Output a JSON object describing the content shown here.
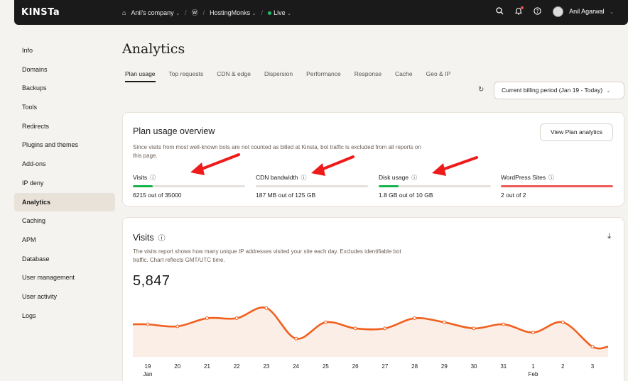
{
  "topbar": {
    "logo": "KINSTa",
    "company": "Anil's company",
    "site": "HostingMonks",
    "env": "Live",
    "user_name": "Anil Agarwal"
  },
  "sidebar": {
    "items": [
      {
        "label": "Info"
      },
      {
        "label": "Domains"
      },
      {
        "label": "Backups"
      },
      {
        "label": "Tools"
      },
      {
        "label": "Redirects"
      },
      {
        "label": "Plugins and themes"
      },
      {
        "label": "Add-ons"
      },
      {
        "label": "IP deny"
      },
      {
        "label": "Analytics",
        "active": true
      },
      {
        "label": "Caching"
      },
      {
        "label": "APM"
      },
      {
        "label": "Database"
      },
      {
        "label": "User management"
      },
      {
        "label": "User activity"
      },
      {
        "label": "Logs"
      }
    ]
  },
  "page": {
    "title": "Analytics",
    "tabs": [
      "Plan usage",
      "Top requests",
      "CDN & edge",
      "Dispersion",
      "Performance",
      "Response",
      "Cache",
      "Geo & IP"
    ],
    "period": "Current billing period (Jan 19 - Today)"
  },
  "plan_usage": {
    "title": "Plan usage overview",
    "description": "Since visits from most well-known bots are not counted as billed at Kinsta, bot traffic is excluded from all reports on this page.",
    "button": "View Plan analytics",
    "metrics": [
      {
        "label": "Visits",
        "value": "6215 out of 35000",
        "fraction": 0.1776,
        "color": "#18b24b"
      },
      {
        "label": "CDN bandwidth",
        "value": "187 MB out of 125 GB",
        "fraction": 0.0015,
        "color": "#18b24b"
      },
      {
        "label": "Disk usage",
        "value": "1.8 GB out of 10 GB",
        "fraction": 0.18,
        "color": "#18b24b"
      },
      {
        "label": "WordPress Sites",
        "value": "2 out of 2",
        "fraction": 1.0,
        "color": "#ee5a55"
      }
    ]
  },
  "visits": {
    "title": "Visits",
    "description": "The visits report shows how many unique IP addresses visited your site each day. Excludes identifiable bot traffic. Chart reflects GMT/UTC time.",
    "total": "5,847"
  },
  "chart_data": {
    "type": "area",
    "x": [
      "19",
      "20",
      "21",
      "22",
      "23",
      "24",
      "25",
      "26",
      "27",
      "28",
      "29",
      "30",
      "31",
      "1",
      "2",
      "3"
    ],
    "month_labels": {
      "19": "Jan",
      "1": "Feb"
    },
    "values": [
      380,
      375,
      395,
      395,
      420,
      345,
      385,
      370,
      370,
      395,
      385,
      370,
      380,
      360,
      385,
      325
    ],
    "ylim": [
      300,
      450
    ],
    "color": "#f0601f",
    "fill": "#fbeee6"
  }
}
